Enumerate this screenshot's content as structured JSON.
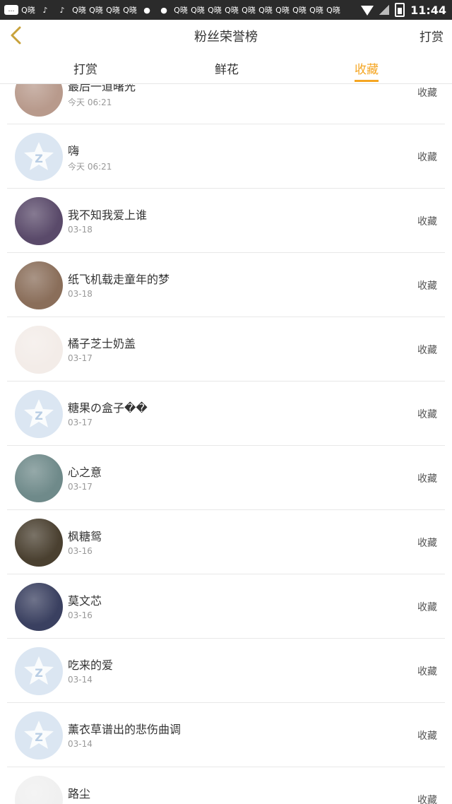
{
  "status_bar": {
    "notif_labels": [
      "…",
      "Q晓",
      "♪",
      "♪",
      "Q晓",
      "Q晓",
      "Q晓",
      "Q晓",
      "●",
      "●",
      "Q晓",
      "Q晓",
      "Q晓",
      "Q晓",
      "Q晓",
      "Q晓",
      "Q晓",
      "Q晓",
      "Q晓",
      "Q晓"
    ],
    "time": "11:44"
  },
  "header": {
    "title": "粉丝荣誉榜",
    "right_link": "打赏",
    "back_icon": "chevron-left-icon",
    "accent_color": "#f5a623"
  },
  "tabs": [
    {
      "label": "打赏",
      "active": false
    },
    {
      "label": "鲜花",
      "active": false
    },
    {
      "label": "收藏",
      "active": true
    }
  ],
  "list": {
    "action_label": "收藏",
    "items": [
      {
        "name": "最后一道曙光",
        "date": "今天 06:21",
        "avatar": "photo-avatar",
        "avatar_color": "#b89a8c"
      },
      {
        "name": "嗨",
        "date": "今天 06:21",
        "avatar": "default-avatar",
        "avatar_color": "#dbe6f2"
      },
      {
        "name": "我不知我爱上谁",
        "date": "03-18",
        "avatar": "photo-avatar",
        "avatar_color": "#5a4a6a"
      },
      {
        "name": "纸飞机载走童年的梦",
        "date": "03-18",
        "avatar": "photo-avatar",
        "avatar_color": "#8a6e5a"
      },
      {
        "name": "橘子芝士奶盖",
        "date": "03-17",
        "avatar": "photo-avatar",
        "avatar_color": "#f3ece8"
      },
      {
        "name": "糖果の盒子��",
        "date": "03-17",
        "avatar": "default-avatar",
        "avatar_color": "#dbe6f2"
      },
      {
        "name": "心之意",
        "date": "03-17",
        "avatar": "photo-avatar",
        "avatar_color": "#6f8a8a"
      },
      {
        "name": "枫糖鸳",
        "date": "03-16",
        "avatar": "photo-avatar",
        "avatar_color": "#4a4030"
      },
      {
        "name": "莫文芯",
        "date": "03-16",
        "avatar": "photo-avatar",
        "avatar_color": "#3a4060"
      },
      {
        "name": "吃来的爱",
        "date": "03-14",
        "avatar": "default-avatar",
        "avatar_color": "#dbe6f2"
      },
      {
        "name": "薰衣草谱出的悲伤曲调",
        "date": "03-14",
        "avatar": "default-avatar",
        "avatar_color": "#dbe6f2"
      },
      {
        "name": "路尘",
        "date": "",
        "avatar": "photo-avatar",
        "avatar_color": "#f0f0f0"
      }
    ]
  }
}
